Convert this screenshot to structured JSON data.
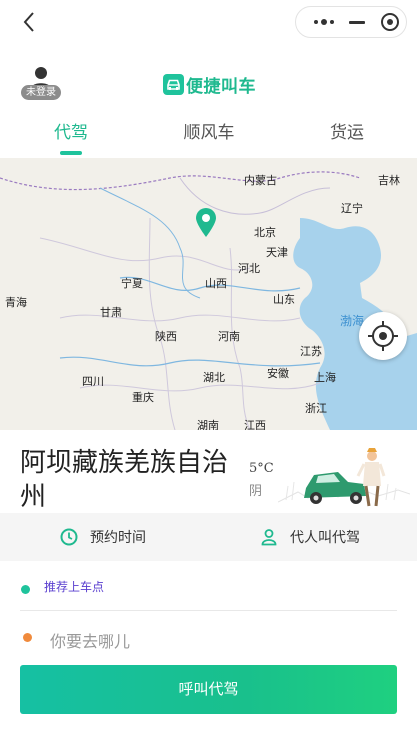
{
  "topbar": {
    "back_icon": "chevron-left-icon",
    "more_icon": "more-icon",
    "minimize_icon": "minimize-icon",
    "close_icon": "target-close-icon"
  },
  "header": {
    "user_status": "未登录",
    "brand_name": "便捷叫车",
    "brand_color": "#1fb98f"
  },
  "tabs": [
    {
      "label": "代驾",
      "active": true
    },
    {
      "label": "顺风车",
      "active": false
    },
    {
      "label": "货运",
      "active": false
    }
  ],
  "map": {
    "labels": [
      "内蒙古",
      "吉林",
      "辽宁",
      "北京",
      "天津",
      "河北",
      "宁夏",
      "山西",
      "青海",
      "甘肃",
      "山东",
      "渤海",
      "陕西",
      "河南",
      "江苏",
      "四川",
      "湖北",
      "安徽",
      "上海",
      "重庆",
      "浙江",
      "湖南",
      "江西"
    ]
  },
  "location": {
    "city": "阿坝藏族羌族自治州",
    "temperature": "5°C",
    "weather": "阴"
  },
  "options": {
    "schedule_label": "预约时间",
    "proxy_label": "代人叫代驾"
  },
  "route": {
    "from_text": "推荐上车点",
    "to_placeholder": "你要去哪儿"
  },
  "actions": {
    "call_label": "呼叫代驾"
  },
  "colors": {
    "accent": "#1fc39c",
    "from_dot": "#1fc39c",
    "to_dot": "#f08a3c",
    "link": "#5a3fcf"
  }
}
